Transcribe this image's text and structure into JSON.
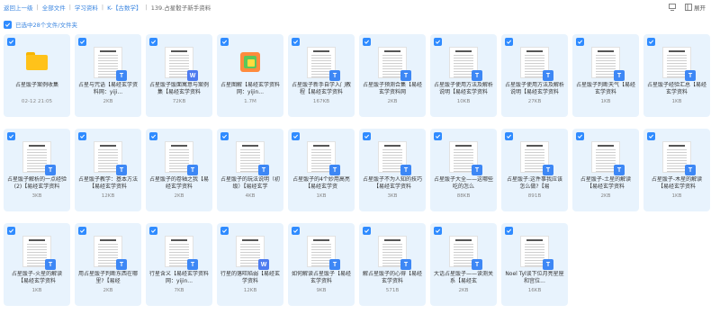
{
  "breadcrumb": [
    {
      "label": "返回上一级",
      "current": false
    },
    {
      "label": "全部文件",
      "current": false
    },
    {
      "label": "学习资料",
      "current": false
    },
    {
      "label": "K-【古数学】",
      "current": false
    },
    {
      "label": "139.占星骰子新手资料",
      "current": true
    }
  ],
  "toolbar": {
    "collapse_label": "展开"
  },
  "selection": {
    "text": "已选中28个文件/文件夹"
  },
  "colors": {
    "accent": "#2f8bff",
    "card_bg": "#e8f3fd",
    "folder": "#ffc21a"
  },
  "files": [
    {
      "name": "占星骰子案例收集",
      "meta": "02-12 21:05",
      "kind": "folder"
    },
    {
      "name": "占星与咒语【易经玄学资料网：yiji...",
      "meta": "2KB",
      "kind": "doc"
    },
    {
      "name": "占星骰子骰面寓意与案例集【易经玄学资料",
      "meta": "72KB",
      "kind": "xls"
    },
    {
      "name": "占星图解【易经玄学资料网：yijin...",
      "meta": "1.7M",
      "kind": "app"
    },
    {
      "name": "占星骰子新手自学入门教程【易经玄学资料",
      "meta": "167KB",
      "kind": "doc"
    },
    {
      "name": "占星骰子预测合集【易经玄学资料网",
      "meta": "2KB",
      "kind": "doc"
    },
    {
      "name": "占星骰子使用方法及解析说明【易经玄学资料",
      "meta": "10KB",
      "kind": "doc"
    },
    {
      "name": "占星骰子使用方法及解析说明【易经玄学资料",
      "meta": "27KB",
      "kind": "doc"
    },
    {
      "name": "占星骰子判断天气【易经玄学资料",
      "meta": "1KB",
      "kind": "doc"
    },
    {
      "name": "占星骰子经验汇总【易经玄学资料",
      "meta": "1KB",
      "kind": "doc"
    },
    {
      "name": "占星骰子解析的一点经验 (2)【易经玄学资料",
      "meta": "3KB",
      "kind": "doc"
    },
    {
      "name": "占星骰子教学：基本方法【易经玄学资料",
      "meta": "12KB",
      "kind": "doc"
    },
    {
      "name": "占星骰子的卷轴之我【易经玄学资料",
      "meta": "2KB",
      "kind": "doc"
    },
    {
      "name": "占星骰子的玩法说明（初级）【易经玄学",
      "meta": "4KB",
      "kind": "doc"
    },
    {
      "name": "占星骰子的4个妙用高亮【易经玄学资",
      "meta": "1KB",
      "kind": "doc"
    },
    {
      "name": "占星骰子不为人知的技巧【易经玄学资料",
      "meta": "3KB",
      "kind": "doc"
    },
    {
      "name": "占星骰子大全——这哪些吃的怎么",
      "meta": "88KB",
      "kind": "doc"
    },
    {
      "name": "占星骰子:这件事我应该怎么做?【易",
      "meta": "891B",
      "kind": "doc"
    },
    {
      "name": "占星骰子-土星的解读【易经玄学资料",
      "meta": "2KB",
      "kind": "doc"
    },
    {
      "name": "占星骰子-木星的解读【易经玄学资料",
      "meta": "1KB",
      "kind": "doc"
    },
    {
      "name": "占星骰子-火星的解读【易经玄学资料",
      "meta": "1KB",
      "kind": "doc"
    },
    {
      "name": "用占星骰子判断东西在哪里?【易经",
      "meta": "2KB",
      "kind": "doc"
    },
    {
      "name": "行星含义【易经玄学资料网：yijin...",
      "meta": "7KB",
      "kind": "doc"
    },
    {
      "name": "行星的落旺陷弱【易经玄学资料",
      "meta": "12KB",
      "kind": "xls"
    },
    {
      "name": "如何解读占星骰子【易经玄学资料",
      "meta": "9KB",
      "kind": "doc"
    },
    {
      "name": "解占星骰子的心得【易经玄学资料",
      "meta": "571B",
      "kind": "doc"
    },
    {
      "name": "大话占星骰子——读测关系【易经玄",
      "meta": "2KB",
      "kind": "doc"
    },
    {
      "name": "Noel Tyl谈下位月亮星座和宫位...",
      "meta": "16KB",
      "kind": "doc"
    }
  ]
}
